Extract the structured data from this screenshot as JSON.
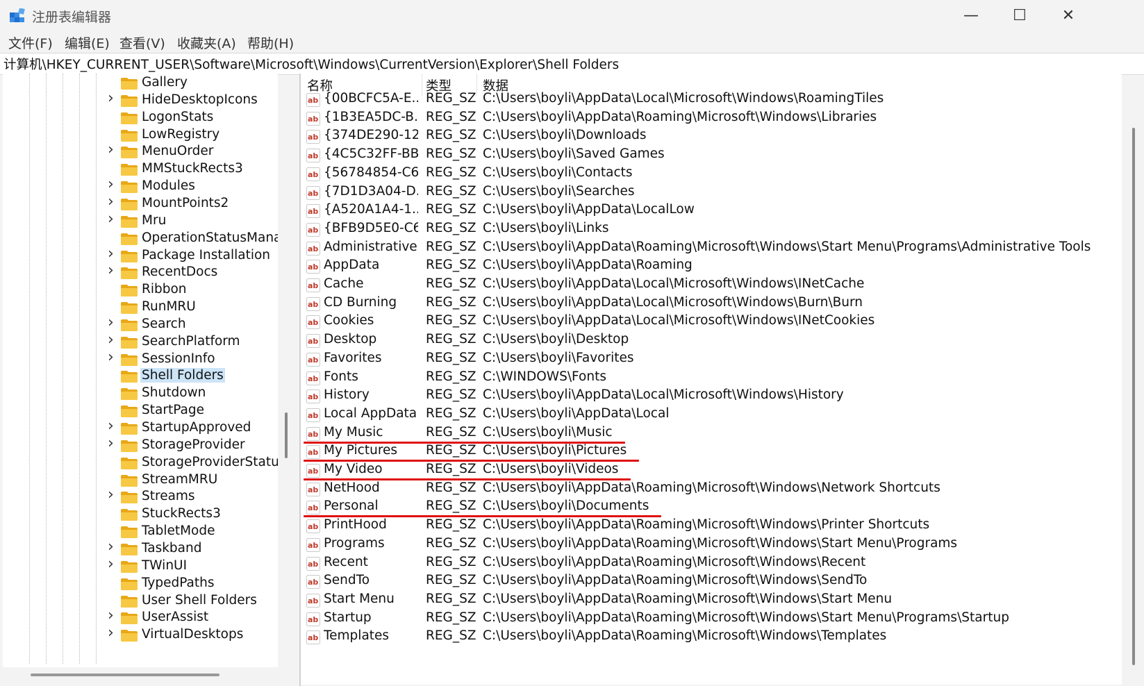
{
  "window": {
    "title": "注册表编辑器",
    "controls": {
      "minimize": "—",
      "maximize": "☐",
      "close": "✕"
    }
  },
  "menu": [
    "文件(F)",
    "编辑(E)",
    "查看(V)",
    "收藏夹(A)",
    "帮助(H)"
  ],
  "address": "计算机\\HKEY_CURRENT_USER\\Software\\Microsoft\\Windows\\CurrentVersion\\Explorer\\Shell Folders",
  "tree": [
    {
      "label": "Gallery",
      "expandable": false
    },
    {
      "label": "HideDesktopIcons",
      "expandable": true
    },
    {
      "label": "LogonStats",
      "expandable": false
    },
    {
      "label": "LowRegistry",
      "expandable": false
    },
    {
      "label": "MenuOrder",
      "expandable": true
    },
    {
      "label": "MMStuckRects3",
      "expandable": false
    },
    {
      "label": "Modules",
      "expandable": true
    },
    {
      "label": "MountPoints2",
      "expandable": true
    },
    {
      "label": "Mru",
      "expandable": true
    },
    {
      "label": "OperationStatusManag",
      "expandable": false
    },
    {
      "label": "Package Installation",
      "expandable": true
    },
    {
      "label": "RecentDocs",
      "expandable": true
    },
    {
      "label": "Ribbon",
      "expandable": false
    },
    {
      "label": "RunMRU",
      "expandable": false
    },
    {
      "label": "Search",
      "expandable": true
    },
    {
      "label": "SearchPlatform",
      "expandable": true
    },
    {
      "label": "SessionInfo",
      "expandable": true
    },
    {
      "label": "Shell Folders",
      "expandable": false,
      "selected": true
    },
    {
      "label": "Shutdown",
      "expandable": false
    },
    {
      "label": "StartPage",
      "expandable": false
    },
    {
      "label": "StartupApproved",
      "expandable": true
    },
    {
      "label": "StorageProvider",
      "expandable": true
    },
    {
      "label": "StorageProviderStatus",
      "expandable": false
    },
    {
      "label": "StreamMRU",
      "expandable": false
    },
    {
      "label": "Streams",
      "expandable": true
    },
    {
      "label": "StuckRects3",
      "expandable": false
    },
    {
      "label": "TabletMode",
      "expandable": false
    },
    {
      "label": "Taskband",
      "expandable": true
    },
    {
      "label": "TWinUI",
      "expandable": true
    },
    {
      "label": "TypedPaths",
      "expandable": false
    },
    {
      "label": "User Shell Folders",
      "expandable": false
    },
    {
      "label": "UserAssist",
      "expandable": true
    },
    {
      "label": "VirtualDesktops",
      "expandable": true
    }
  ],
  "columns": {
    "name": "名称",
    "type": "类型",
    "data": "数据"
  },
  "rows": [
    {
      "name": "{00BCFC5A-E...",
      "type": "REG_SZ",
      "data": "C:\\Users\\boyli\\AppData\\Local\\Microsoft\\Windows\\RoamingTiles"
    },
    {
      "name": "{1B3EA5DC-B...",
      "type": "REG_SZ",
      "data": "C:\\Users\\boyli\\AppData\\Roaming\\Microsoft\\Windows\\Libraries"
    },
    {
      "name": "{374DE290-12...",
      "type": "REG_SZ",
      "data": "C:\\Users\\boyli\\Downloads"
    },
    {
      "name": "{4C5C32FF-BB...",
      "type": "REG_SZ",
      "data": "C:\\Users\\boyli\\Saved Games"
    },
    {
      "name": "{56784854-C6...",
      "type": "REG_SZ",
      "data": "C:\\Users\\boyli\\Contacts"
    },
    {
      "name": "{7D1D3A04-D...",
      "type": "REG_SZ",
      "data": "C:\\Users\\boyli\\Searches"
    },
    {
      "name": "{A520A1A4-1...",
      "type": "REG_SZ",
      "data": "C:\\Users\\boyli\\AppData\\LocalLow"
    },
    {
      "name": "{BFB9D5E0-C6...",
      "type": "REG_SZ",
      "data": "C:\\Users\\boyli\\Links"
    },
    {
      "name": "Administrative...",
      "type": "REG_SZ",
      "data": "C:\\Users\\boyli\\AppData\\Roaming\\Microsoft\\Windows\\Start Menu\\Programs\\Administrative Tools"
    },
    {
      "name": "AppData",
      "type": "REG_SZ",
      "data": "C:\\Users\\boyli\\AppData\\Roaming"
    },
    {
      "name": "Cache",
      "type": "REG_SZ",
      "data": "C:\\Users\\boyli\\AppData\\Local\\Microsoft\\Windows\\INetCache"
    },
    {
      "name": "CD Burning",
      "type": "REG_SZ",
      "data": "C:\\Users\\boyli\\AppData\\Local\\Microsoft\\Windows\\Burn\\Burn"
    },
    {
      "name": "Cookies",
      "type": "REG_SZ",
      "data": "C:\\Users\\boyli\\AppData\\Local\\Microsoft\\Windows\\INetCookies"
    },
    {
      "name": "Desktop",
      "type": "REG_SZ",
      "data": "C:\\Users\\boyli\\Desktop"
    },
    {
      "name": "Favorites",
      "type": "REG_SZ",
      "data": "C:\\Users\\boyli\\Favorites"
    },
    {
      "name": "Fonts",
      "type": "REG_SZ",
      "data": "C:\\WINDOWS\\Fonts"
    },
    {
      "name": "History",
      "type": "REG_SZ",
      "data": "C:\\Users\\boyli\\AppData\\Local\\Microsoft\\Windows\\History"
    },
    {
      "name": "Local AppData",
      "type": "REG_SZ",
      "data": "C:\\Users\\boyli\\AppData\\Local"
    },
    {
      "name": "My Music",
      "type": "REG_SZ",
      "data": "C:\\Users\\boyli\\Music",
      "marked": true
    },
    {
      "name": "My Pictures",
      "type": "REG_SZ",
      "data": "C:\\Users\\boyli\\Pictures",
      "marked": true
    },
    {
      "name": "My Video",
      "type": "REG_SZ",
      "data": "C:\\Users\\boyli\\Videos",
      "marked": true
    },
    {
      "name": "NetHood",
      "type": "REG_SZ",
      "data": "C:\\Users\\boyli\\AppData\\Roaming\\Microsoft\\Windows\\Network Shortcuts"
    },
    {
      "name": "Personal",
      "type": "REG_SZ",
      "data": "C:\\Users\\boyli\\Documents",
      "marked": true
    },
    {
      "name": "PrintHood",
      "type": "REG_SZ",
      "data": "C:\\Users\\boyli\\AppData\\Roaming\\Microsoft\\Windows\\Printer Shortcuts"
    },
    {
      "name": "Programs",
      "type": "REG_SZ",
      "data": "C:\\Users\\boyli\\AppData\\Roaming\\Microsoft\\Windows\\Start Menu\\Programs"
    },
    {
      "name": "Recent",
      "type": "REG_SZ",
      "data": "C:\\Users\\boyli\\AppData\\Roaming\\Microsoft\\Windows\\Recent"
    },
    {
      "name": "SendTo",
      "type": "REG_SZ",
      "data": "C:\\Users\\boyli\\AppData\\Roaming\\Microsoft\\Windows\\SendTo"
    },
    {
      "name": "Start Menu",
      "type": "REG_SZ",
      "data": "C:\\Users\\boyli\\AppData\\Roaming\\Microsoft\\Windows\\Start Menu"
    },
    {
      "name": "Startup",
      "type": "REG_SZ",
      "data": "C:\\Users\\boyli\\AppData\\Roaming\\Microsoft\\Windows\\Start Menu\\Programs\\Startup"
    },
    {
      "name": "Templates",
      "type": "REG_SZ",
      "data": "C:\\Users\\boyli\\AppData\\Roaming\\Microsoft\\Windows\\Templates"
    }
  ],
  "colors": {
    "selection": "#cce4f7",
    "annotation": "#e01010",
    "icon_red": "#c0392b",
    "folder": "#f2c230"
  },
  "icons": {
    "value": "string-value-ab-icon",
    "folder": "folder-icon",
    "expander": "chevron-right-icon"
  }
}
